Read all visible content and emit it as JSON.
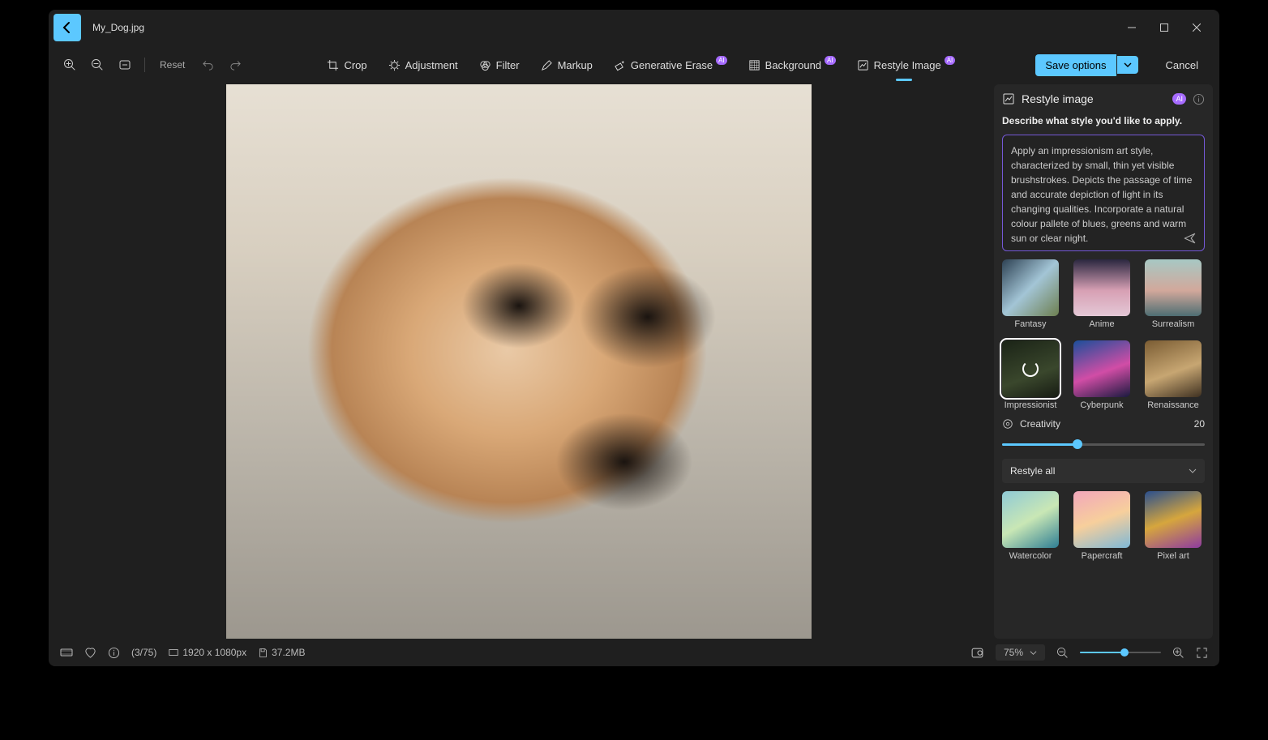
{
  "file_name": "My_Dog.jpg",
  "toolbar": {
    "reset_label": "Reset",
    "save_label": "Save options",
    "cancel_label": "Cancel"
  },
  "tools": {
    "crop": "Crop",
    "adjustment": "Adjustment",
    "filter": "Filter",
    "markup": "Markup",
    "generative_erase": "Generative Erase",
    "background": "Background",
    "restyle_image": "Restyle Image",
    "ai_badge": "AI"
  },
  "panel": {
    "title": "Restyle image",
    "ai_badge": "AI",
    "describe_label": "Describe what style you'd like to apply.",
    "prompt_text": "Apply an impressionism art style, characterized by small, thin yet visible brushstrokes. Depicts the passage of time and accurate depiction of light in its changing qualities. Incorporate a natural colour pallete of blues, greens and warm sun or clear night.",
    "creativity_label": "Creativity",
    "creativity_value": "20",
    "restyle_all_label": "Restyle all"
  },
  "styles_row1": [
    {
      "label": "Fantasy"
    },
    {
      "label": "Anime"
    },
    {
      "label": "Surrealism"
    }
  ],
  "styles_row2": [
    {
      "label": "Impressionist"
    },
    {
      "label": "Cyberpunk"
    },
    {
      "label": "Renaissance"
    }
  ],
  "styles_row3": [
    {
      "label": "Watercolor"
    },
    {
      "label": "Papercraft"
    },
    {
      "label": "Pixel art"
    }
  ],
  "status": {
    "page": "(3/75)",
    "dimensions": "1920 x 1080px",
    "filesize": "37.2MB",
    "zoom": "75%"
  }
}
